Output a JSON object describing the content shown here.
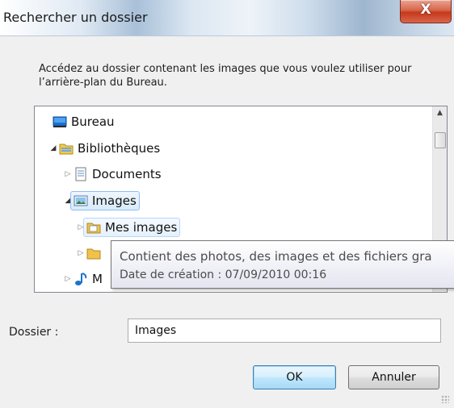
{
  "window": {
    "title": "Rechercher un dossier",
    "close_label": "X"
  },
  "description": "Accédez au dossier contenant les images que vous voulez utiliser pour l’arrière-plan du Bureau.",
  "tree": {
    "items": [
      {
        "label": "Bureau",
        "icon": "desktop-icon",
        "state": "none"
      },
      {
        "label": "Bibliothèques",
        "icon": "library-folder-icon",
        "state": "expanded"
      },
      {
        "label": "Documents",
        "icon": "documents-library-icon",
        "state": "collapsed"
      },
      {
        "label": "Images",
        "icon": "pictures-library-icon",
        "state": "expanded",
        "selected": true
      },
      {
        "label": "Mes images",
        "icon": "folder-icon",
        "state": "collapsed",
        "hovered": true
      },
      {
        "label": "",
        "icon": "folder-icon",
        "state": "collapsed"
      },
      {
        "label": "M",
        "icon": "music-library-icon",
        "state": "collapsed"
      }
    ]
  },
  "tooltip": {
    "line1": "Contient des photos, des images et des fichiers gra",
    "line2": "Date de création : 07/09/2010 00:16"
  },
  "folder_field": {
    "label": "Dossier :",
    "value": "Images"
  },
  "buttons": {
    "ok": "OK",
    "cancel": "Annuler"
  },
  "colors": {
    "selection_border": "#8fbef0",
    "default_button_border": "#3c7fb1",
    "close_button": "#c5391b"
  }
}
